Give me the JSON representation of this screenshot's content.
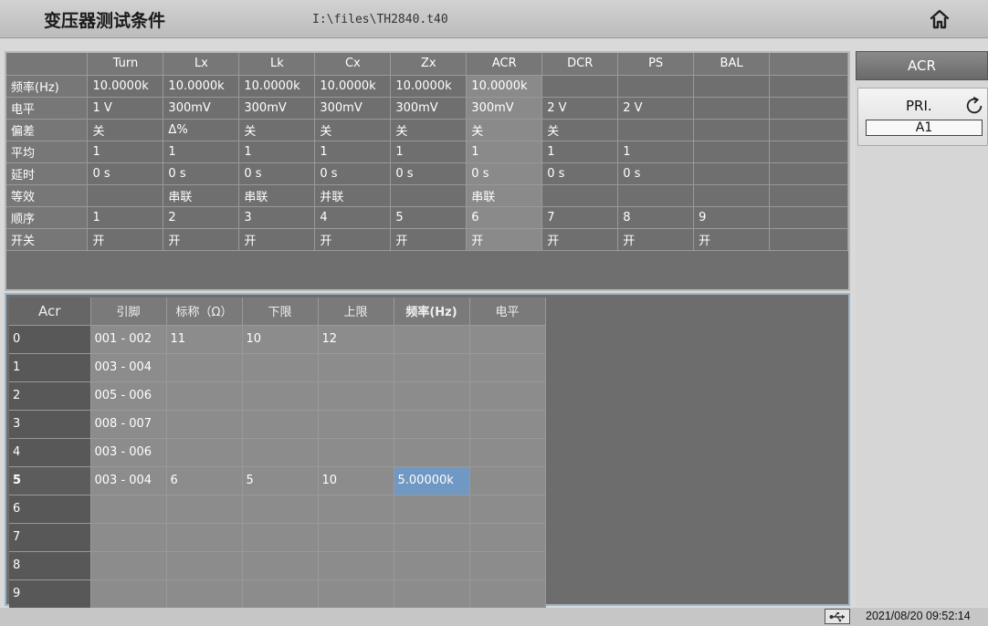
{
  "header": {
    "title": "变压器测试条件",
    "file_path": "I:\\files\\TH2840.t40",
    "home_icon": "home-icon"
  },
  "param_table": {
    "columns": [
      "",
      "Turn",
      "Lx",
      "Lk",
      "Cx",
      "Zx",
      "ACR",
      "DCR",
      "PS",
      "BAL"
    ],
    "rows": [
      {
        "label": "频率(Hz)",
        "cells": [
          "10.0000k",
          "10.0000k",
          "10.0000k",
          "10.0000k",
          "10.0000k",
          "10.0000k",
          "",
          "",
          ""
        ]
      },
      {
        "label": "电平",
        "cells": [
          "1 V",
          "300mV",
          "300mV",
          "300mV",
          "300mV",
          "300mV",
          "2 V",
          "2 V",
          ""
        ]
      },
      {
        "label": "偏差",
        "cells": [
          "关",
          "Δ%",
          "关",
          "关",
          "关",
          "关",
          "关",
          "",
          ""
        ]
      },
      {
        "label": "平均",
        "cells": [
          "1",
          "1",
          "1",
          "1",
          "1",
          "1",
          "1",
          "1",
          ""
        ]
      },
      {
        "label": "延时",
        "cells": [
          "0 s",
          "0 s",
          "0 s",
          "0 s",
          "0 s",
          "0 s",
          "0 s",
          "0 s",
          ""
        ]
      },
      {
        "label": "等效",
        "cells": [
          "",
          "串联",
          "串联",
          "并联",
          "",
          "串联",
          "",
          "",
          ""
        ]
      },
      {
        "label": "顺序",
        "cells": [
          "1",
          "2",
          "3",
          "4",
          "5",
          "6",
          "7",
          "8",
          "9"
        ]
      },
      {
        "label": "开关",
        "cells": [
          "开",
          "开",
          "开",
          "开",
          "开",
          "开",
          "开",
          "开",
          "开"
        ]
      }
    ]
  },
  "acr_table": {
    "columns": [
      "Acr",
      "引脚",
      "标称（Ω）",
      "下限",
      "上限",
      "频率(Hz)",
      "电平"
    ],
    "rows": [
      {
        "index": "0",
        "cells": [
          "001 - 002",
          "11",
          "10",
          "12",
          "",
          ""
        ]
      },
      {
        "index": "1",
        "cells": [
          "003 - 004",
          "",
          "",
          "",
          "",
          ""
        ]
      },
      {
        "index": "2",
        "cells": [
          "005 - 006",
          "",
          "",
          "",
          "",
          ""
        ]
      },
      {
        "index": "3",
        "cells": [
          "008 - 007",
          "",
          "",
          "",
          "",
          ""
        ]
      },
      {
        "index": "4",
        "cells": [
          "003 - 006",
          "",
          "",
          "",
          "",
          ""
        ]
      },
      {
        "index": "5",
        "cells": [
          "003 - 004",
          "6",
          "5",
          "10",
          "5.00000k",
          ""
        ]
      },
      {
        "index": "6",
        "cells": [
          "",
          "",
          "",
          "",
          "",
          ""
        ]
      },
      {
        "index": "7",
        "cells": [
          "",
          "",
          "",
          "",
          "",
          ""
        ]
      },
      {
        "index": "8",
        "cells": [
          "",
          "",
          "",
          "",
          "",
          ""
        ]
      },
      {
        "index": "9",
        "cells": [
          "",
          "",
          "",
          "",
          "",
          ""
        ]
      }
    ],
    "active_row": "5",
    "selected_column": "频率(Hz)"
  },
  "side_panel": {
    "title": "ACR",
    "button_label": "PRI.",
    "button_value": "A1",
    "cycle_icon": "cycle-icon"
  },
  "status": {
    "usb_icon": "usb-icon",
    "datetime": "2021/08/20 09:52:14"
  },
  "colors": {
    "panel_bg": "#6f6f6f",
    "selected_cell": "#6f98c4",
    "acr_column_highlight": "#8a8a8a"
  }
}
